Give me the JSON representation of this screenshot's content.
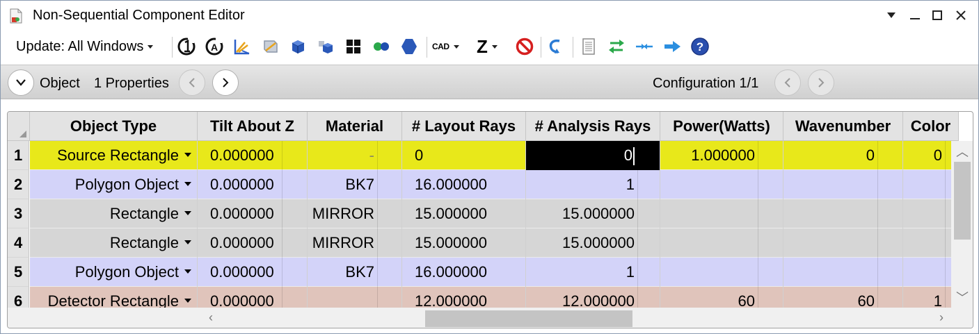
{
  "window": {
    "title": "Non-Sequential Component Editor",
    "controls": {
      "menu": "▼",
      "minimize": "—",
      "maximize": "☐",
      "close": "✕"
    }
  },
  "toolbar": {
    "update_label": "Update: All Windows",
    "cad_label": "CAD",
    "z_label": "Z",
    "icons": [
      "reset-icon",
      "auto-icon",
      "ray-trace-icon",
      "layout-icon",
      "solid-model-icon",
      "shaded-model-icon",
      "grid-icon",
      "dots-icon",
      "hexagon-icon",
      "cad-icon",
      "z-icon",
      "stop-icon",
      "undo-icon",
      "notes-icon",
      "swap-icon",
      "convert-icon",
      "arrow-icon",
      "help-icon"
    ]
  },
  "object_bar": {
    "object_label": "Object",
    "properties_label": "1 Properties",
    "configuration_label": "Configuration 1/1"
  },
  "table": {
    "columns": [
      "Object Type",
      "Tilt About Z",
      "Material",
      "# Layout Rays",
      "# Analysis Rays",
      "Power(Watts)",
      "Wavenumber",
      "Color"
    ],
    "rows": [
      {
        "num": "1",
        "type": "Source Rectangle",
        "tilt": "0.000000",
        "material": "-",
        "layout": "0",
        "analysis": "0",
        "power": "1.000000",
        "wavenumber": "0",
        "color": "0",
        "bg": "#e8e81a"
      },
      {
        "num": "2",
        "type": "Polygon Object",
        "tilt": "0.000000",
        "material": "BK7",
        "layout": "16.000000",
        "analysis": "1",
        "power": "",
        "wavenumber": "",
        "color": "",
        "bg": "#d3d3f9"
      },
      {
        "num": "3",
        "type": "Rectangle",
        "tilt": "0.000000",
        "material": "MIRROR",
        "layout": "15.000000",
        "analysis": "15.000000",
        "power": "",
        "wavenumber": "",
        "color": "",
        "bg": "#d6d6d6"
      },
      {
        "num": "4",
        "type": "Rectangle",
        "tilt": "0.000000",
        "material": "MIRROR",
        "layout": "15.000000",
        "analysis": "15.000000",
        "power": "",
        "wavenumber": "",
        "color": "",
        "bg": "#d6d6d6"
      },
      {
        "num": "5",
        "type": "Polygon Object",
        "tilt": "0.000000",
        "material": "BK7",
        "layout": "16.000000",
        "analysis": "1",
        "power": "",
        "wavenumber": "",
        "color": "",
        "bg": "#d3d3f9"
      },
      {
        "num": "6",
        "type": "Detector Rectangle",
        "tilt": "0.000000",
        "material": "",
        "layout": "12.000000",
        "analysis": "12.000000",
        "power": "60",
        "wavenumber": "60",
        "color": "1",
        "bg": "#e0c4bb"
      }
    ]
  },
  "colors": {
    "source_row": "#e8e81a",
    "polygon_row": "#d3d3f9",
    "mirror_row": "#d6d6d6",
    "detector_row": "#e0c4bb",
    "selected_cell": "#000000"
  }
}
